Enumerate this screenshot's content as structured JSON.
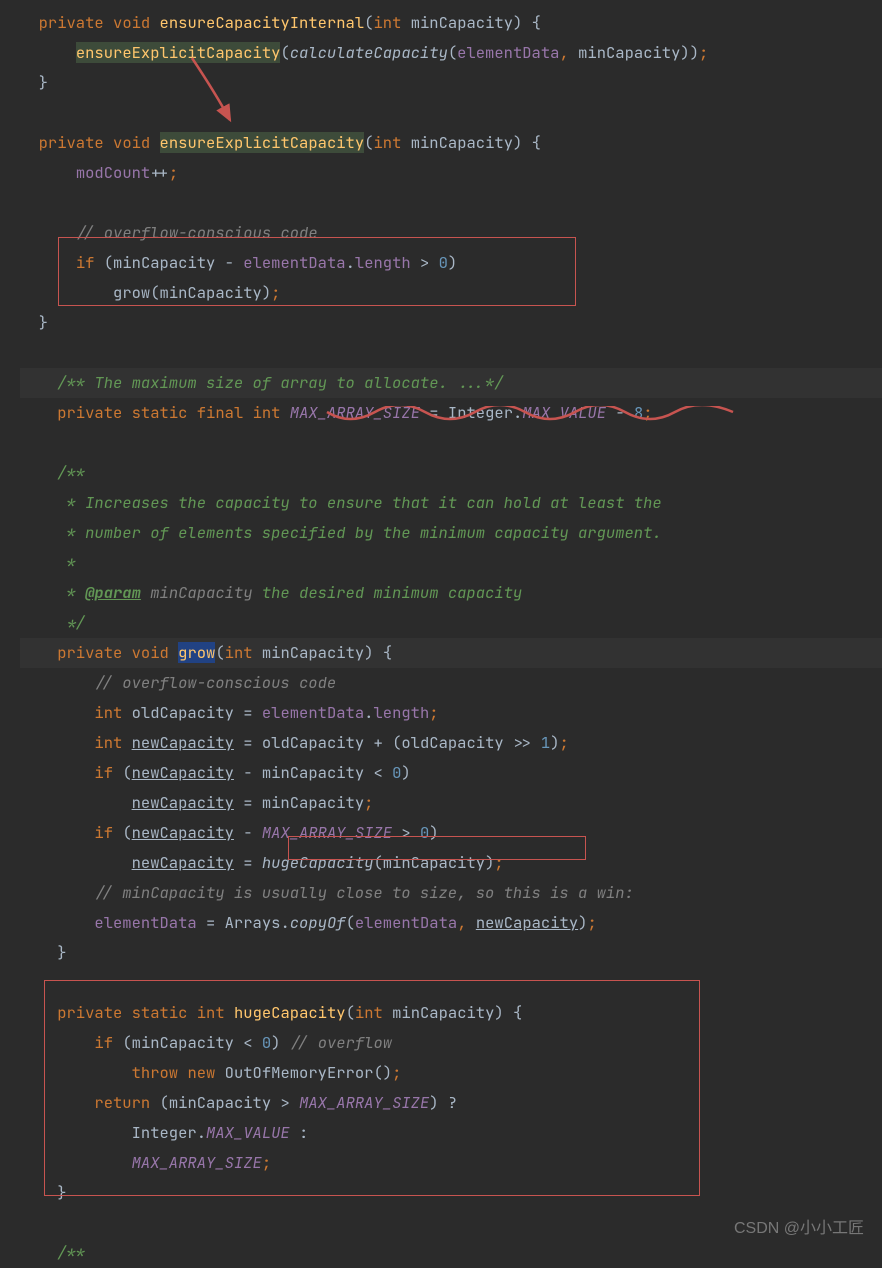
{
  "colors": {
    "background": "#2b2b2b",
    "text": "#a9b7c6",
    "keyword": "#cc7832",
    "method": "#ffc66d",
    "field": "#9876aa",
    "comment_doc": "#629755",
    "comment": "#808080",
    "number": "#6897bb",
    "selection_bg": "#214283",
    "method_highlight_bg": "#3d4b3a",
    "red_annotation": "#c75450"
  },
  "watermark": "CSDN @小小工匠",
  "code": {
    "m1": {
      "kw_private": "private",
      "kw_void": "void",
      "name": "ensureCapacityInternal",
      "param_type": "int",
      "param_name": "minCapacity",
      "body_call1": "ensureExplicitCapacity",
      "body_call2": "calculateCapacity",
      "body_arg1": "elementData",
      "body_arg2": "minCapacity"
    },
    "m2": {
      "kw_private": "private",
      "kw_void": "void",
      "name": "ensureExplicitCapacity",
      "param_type": "int",
      "param_name": "minCapacity",
      "l1_modcount": "modCount",
      "l1_pp": "++",
      "c1": "// overflow-conscious code",
      "if_kw": "if",
      "if_a": "minCapacity",
      "if_b": "elementData",
      "if_c": "length",
      "if_zero": "0",
      "grow": "grow",
      "grow_arg": "minCapacity"
    },
    "const": {
      "doc": "/** The maximum size of array to allocate. ...*/",
      "kw_private": "private",
      "kw_static": "static",
      "kw_final": "final",
      "kw_int": "int",
      "name": "MAX_ARRAY_SIZE",
      "rhs_cls": "Integer",
      "rhs_field": "MAX_VALUE",
      "rhs_num": "8"
    },
    "doc2": {
      "l0": "/**",
      "l1": " * Increases the capacity to ensure that it can hold at least the",
      "l2": " * number of elements specified by the minimum capacity argument.",
      "l3": " *",
      "l4a": " * ",
      "l4_tag": "@param",
      "l4b": " minCapacity",
      "l4c": " the desired minimum capacity",
      "l5": " */"
    },
    "grow": {
      "kw_private": "private",
      "kw_void": "void",
      "name": "grow",
      "param_type": "int",
      "param_name": "minCapacity",
      "c1": "// overflow-conscious code",
      "kw_int": "int",
      "old": "oldCapacity",
      "ed": "elementData",
      "len": "length",
      "new": "newCapacity",
      "one": "1",
      "if_kw": "if",
      "zero": "0",
      "mas": "MAX_ARRAY_SIZE",
      "hc": "hugeCapacity",
      "mc": "minCapacity",
      "c2": "// minCapacity is usually close to size, so this is a win:",
      "arr": "Arrays",
      "copy": "copyOf"
    },
    "huge": {
      "kw_private": "private",
      "kw_static": "static",
      "kw_int": "int",
      "name": "hugeCapacity",
      "param_type": "int",
      "param_name": "minCapacity",
      "if_kw": "if",
      "zero": "0",
      "c_overflow": "// overflow",
      "throw_kw": "throw",
      "new_kw": "new",
      "err": "OutOfMemoryError",
      "ret": "return",
      "mas": "MAX_ARRAY_SIZE",
      "int_cls": "Integer",
      "max_val": "MAX_VALUE"
    },
    "last_doc": "/**"
  }
}
